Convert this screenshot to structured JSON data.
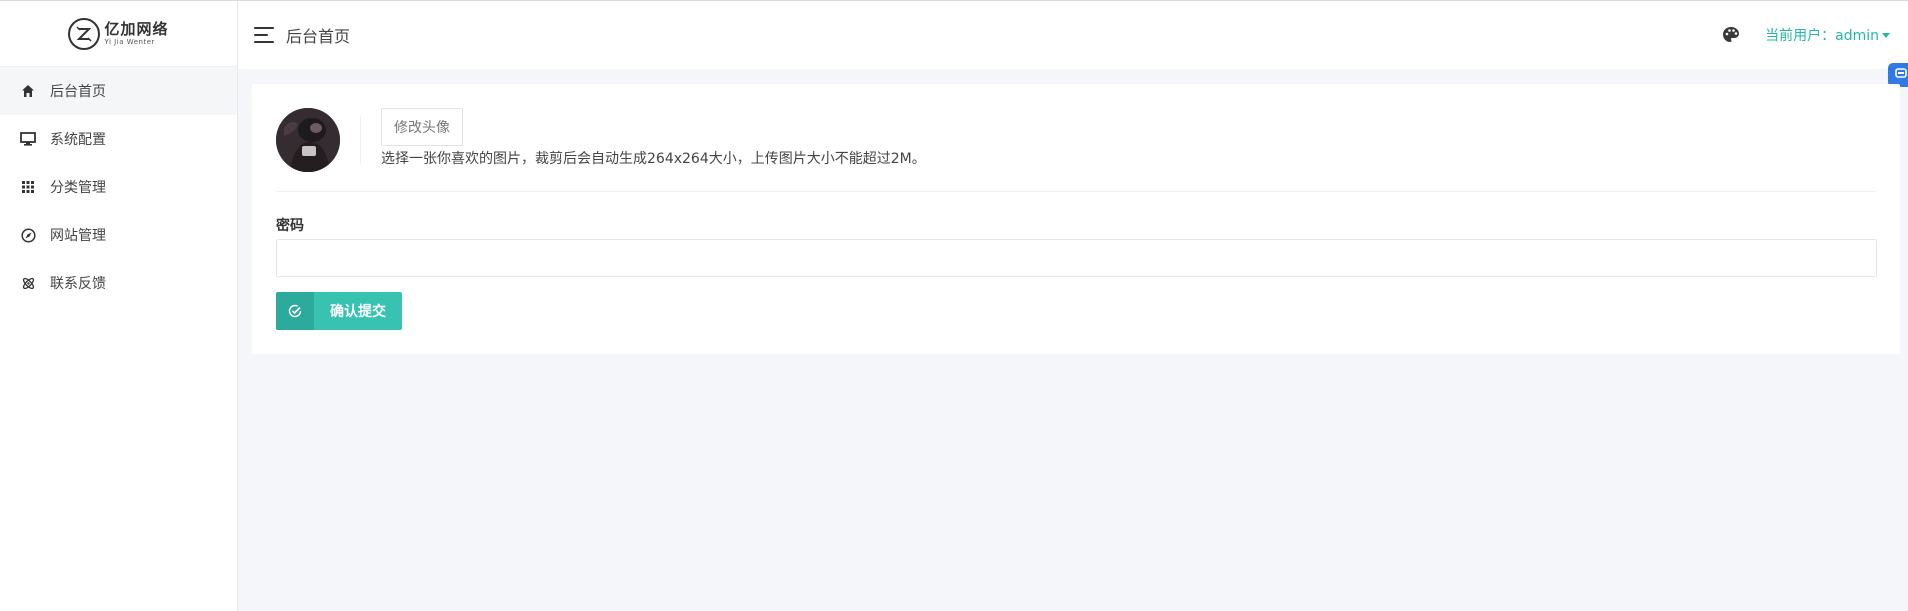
{
  "brand": {
    "logo_text": "亿加网络",
    "logo_subtext": "Yi Jia Wenter"
  },
  "sidebar": {
    "items": [
      {
        "label": "后台首页",
        "icon": "home-icon",
        "active": true
      },
      {
        "label": "系统配置",
        "icon": "monitor-icon",
        "active": false
      },
      {
        "label": "分类管理",
        "icon": "grid-icon",
        "active": false
      },
      {
        "label": "网站管理",
        "icon": "compass-icon",
        "active": false
      },
      {
        "label": "联系反馈",
        "icon": "atom-icon",
        "active": false
      }
    ]
  },
  "header": {
    "page_title": "后台首页",
    "user_label": "当前用户：admin"
  },
  "profile": {
    "change_avatar_label": "修改头像",
    "avatar_hint": "选择一张你喜欢的图片，裁剪后会自动生成264x264大小，上传图片大小不能超过2M。"
  },
  "form": {
    "password_label": "密码",
    "password_value": "",
    "submit_label": "确认提交"
  },
  "colors": {
    "accent": "#37c2b1",
    "accent_dark": "#2caa9b",
    "user_link": "#26b6a6",
    "edge_tab": "#2f7ae5"
  }
}
